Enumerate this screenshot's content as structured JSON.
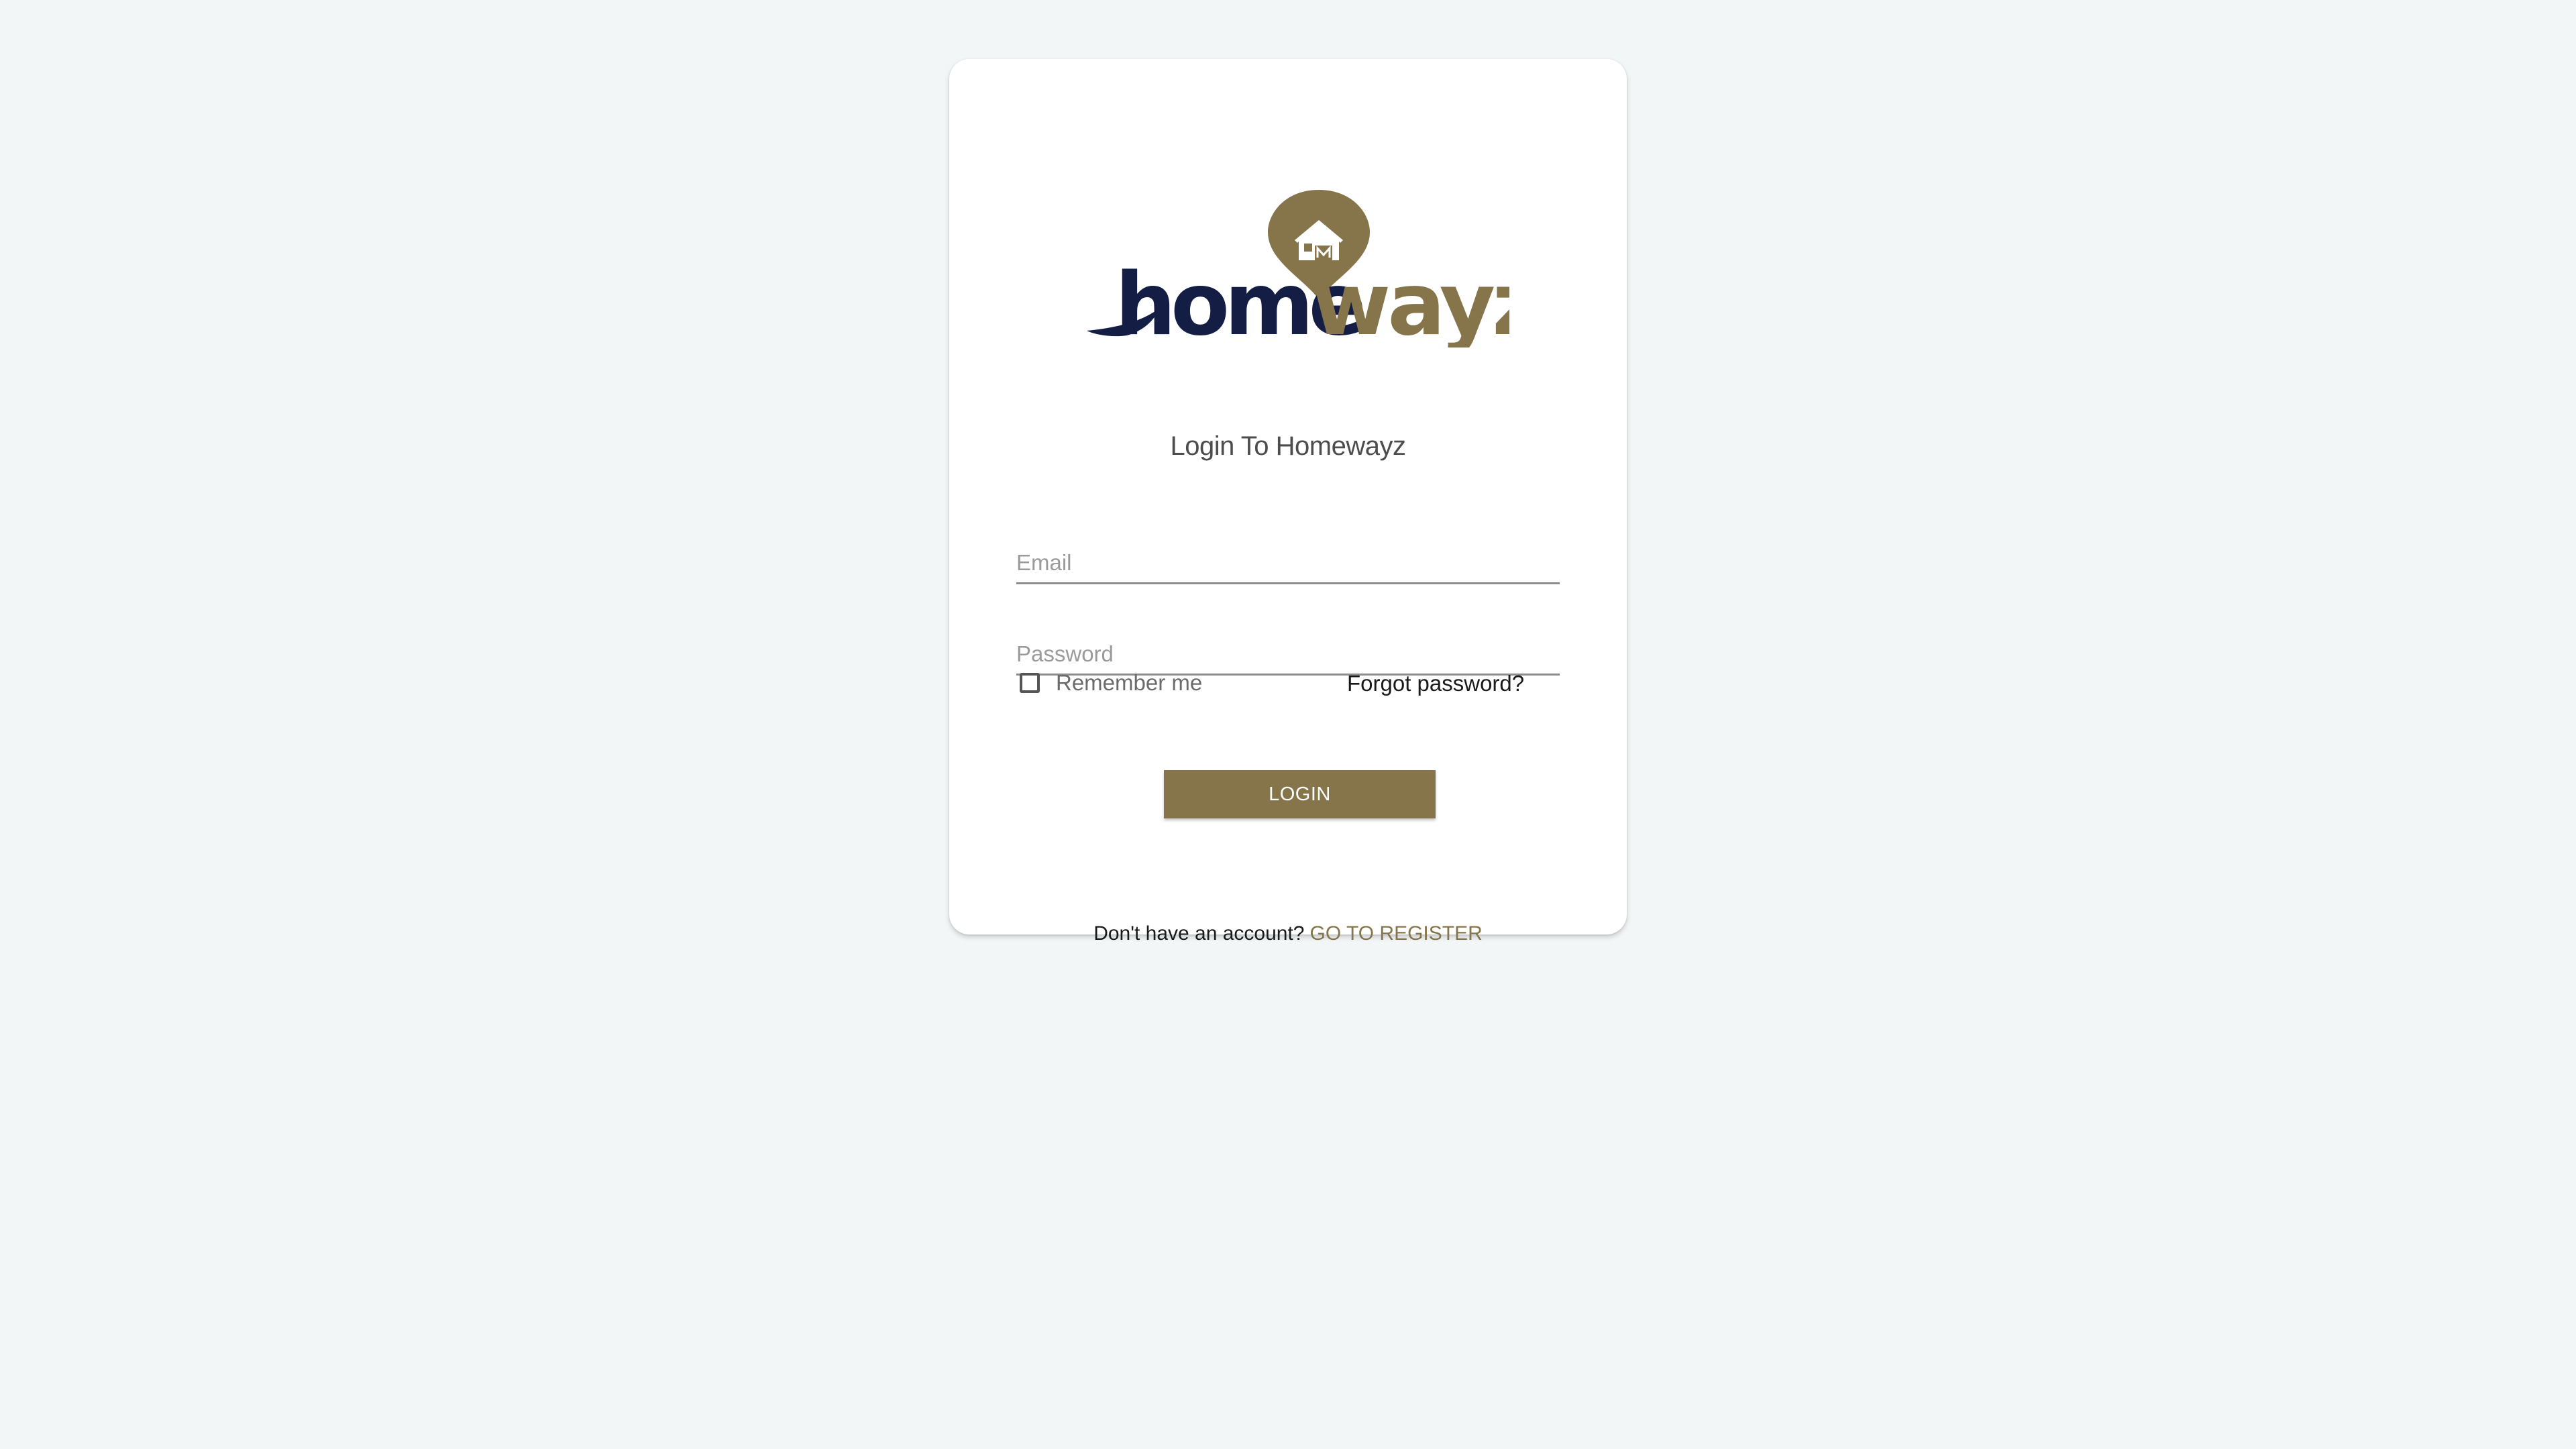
{
  "brand": {
    "wordmark_dark": "home",
    "wordmark_light": "wayz",
    "primary_color": "#86754a",
    "dark_color": "#141e45"
  },
  "login": {
    "title": "Login To Homewayz",
    "email_placeholder": "Email",
    "email_value": "",
    "password_placeholder": "Password",
    "password_value": "",
    "remember_label": "Remember me",
    "remember_checked": false,
    "forgot_label": "Forgot password?",
    "login_button": "LOGIN",
    "register_prompt": "Don't have an account?",
    "register_link": "GO TO REGISTER"
  }
}
